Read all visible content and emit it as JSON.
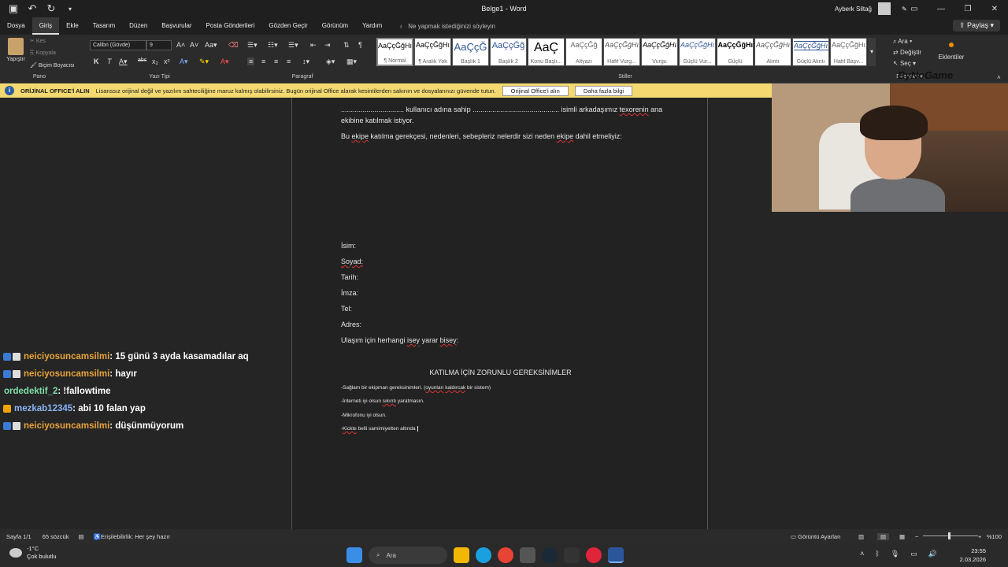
{
  "titlebar": {
    "doc_title": "Belge1  -  Word",
    "user_name": "Ayberk Siltağ",
    "qat": [
      "save-icon",
      "undo-icon",
      "redo-icon",
      "customize-icon"
    ]
  },
  "menu": {
    "tabs": [
      "Dosya",
      "Giriş",
      "Ekle",
      "Tasarım",
      "Düzen",
      "Başvurular",
      "Posta Gönderileri",
      "Gözden Geçir",
      "Görünüm",
      "Yardım"
    ],
    "active_index": 1,
    "tellme": "Ne yapmak istediğinizi söyleyin",
    "share": "Paylaş"
  },
  "ribbon": {
    "paste": "Yapıştır",
    "cut": "Kes",
    "copy": "Kopyala",
    "format_painter": "Biçim Boyacısı",
    "font": "Calibri (Gövde)",
    "size": "9",
    "groups": {
      "pano": "Pano",
      "yazi_tipi": "Yazı Tipi",
      "paragraf": "Paragraf",
      "stiller": "Stiller",
      "duzenleme": "Düzenleme"
    },
    "styles": [
      {
        "sample": "AaÇçĞğHı",
        "name": "¶ Normal"
      },
      {
        "sample": "AaÇçĞğHı",
        "name": "¶ Aralık Yok"
      },
      {
        "sample": "AaÇçĞ",
        "name": "Başlık 1"
      },
      {
        "sample": "AaÇçĞğ",
        "name": "Başlık 2"
      },
      {
        "sample": "AaÇ",
        "name": "Konu Başlı..."
      },
      {
        "sample": "AaÇçĞğ",
        "name": "Altyazı"
      },
      {
        "sample": "AaÇçĞğHı",
        "name": "Hafif Vurg..."
      },
      {
        "sample": "AaÇçĞğHı",
        "name": "Vurgu"
      },
      {
        "sample": "AaÇçĞğHı",
        "name": "Güçlü Vur..."
      },
      {
        "sample": "AaÇçĞğHı",
        "name": "Güçlü"
      },
      {
        "sample": "AaÇçĞğHı",
        "name": "Alıntı"
      },
      {
        "sample": "AaÇçĞğHı",
        "name": "Güçlü Alıntı"
      },
      {
        "sample": "AaÇçĞğHı",
        "name": "Hafif Başv..."
      }
    ],
    "find": "Ara",
    "replace": "Değiştir",
    "select": "Seç",
    "addins": "Eklentiler",
    "watermark": "ByNoGame"
  },
  "notice": {
    "title": "ORİJİNAL OFFICE'İ ALIN",
    "text": "Lisanssız orijinal değil ve yazılım sahteciliğine maruz kalmış olabilirsiniz. Bugün orijinal Office alarak kesintilerden sakının ve dosyalarınızı güvende tutun.",
    "btn_get": "Orijinal Office'i alın",
    "btn_more": "Daha fazla bilgi"
  },
  "document": {
    "line1a": "................................ kullanıcı adına sahip ............................................ isimli arkadaşımız ",
    "line1b": "texorenin",
    "line1c": " ana",
    "line2": "ekibine katılmak istiyor.",
    "line3a": "Bu ",
    "line3b": "ekipe",
    "line3c": " katılma gerekçesi, nedenleri, sebepleriz nelerdir sizi neden ",
    "line3d": "ekipe",
    "line3e": " dahil etmeliyiz:",
    "fields": [
      "İsim:",
      "Soyad:",
      "Tarih:",
      "İmza:",
      "Tel:",
      "Adres:"
    ],
    "contact_a": "Ulaşım için herhangi ",
    "contact_b": "isey",
    "contact_c": " yarar ",
    "contact_d": "bisey",
    "contact_e": ":",
    "heading": "KATILMA İÇİN ZORUNLU GEREKSİNİMLER",
    "req1a": "-Sağlam bir ekipman gereksinimleri. (",
    "req1b": "oyunları",
    "req1c": " ",
    "req1d": "kaldırcak",
    "req1e": " bir sistem)",
    "req2a": "-İnterneti iyi olsun ",
    "req2b": "sıkıntı",
    "req2c": " yaratmasın.",
    "req3": "-Mikrofonu iyi olsun.",
    "req4a": "-",
    "req4b": "Kickte",
    "req4c": " belli samimiyetten altında"
  },
  "chat": [
    {
      "user": "neiciyosuncamsilmi",
      "msg": " : 15 günü 3 ayda kasamadılar aq",
      "color": "#e8a33a",
      "badges": true
    },
    {
      "user": "neiciyosuncamsilmi",
      "msg": " : hayır",
      "color": "#e8a33a",
      "badges": true
    },
    {
      "user": "ordedektif_2",
      "msg": " : !fallowtime",
      "color": "#7fe0a8",
      "badges": false
    },
    {
      "user": "mezkab12345",
      "msg": " : abi 10 falan yap",
      "color": "#8ab4f8",
      "badges": "gold"
    },
    {
      "user": "neiciyosuncamsilmi",
      "msg": " : düşünmüyorum",
      "color": "#e8a33a",
      "badges": true
    }
  ],
  "status": {
    "page": "Sayfa 1/1",
    "words": "65 sözcük",
    "accessibility": "Erişilebilirlik: Her şey hazır",
    "display": "Görüntü Ayarları",
    "zoom": "%100"
  },
  "taskbar": {
    "temp": "-1°C",
    "weather": "Çok bulutlu",
    "weather_badge": "3",
    "search": "Ara",
    "time": "23:55",
    "date": "2.03.2026"
  },
  "colors": {
    "notice_bg": "#f3d970",
    "accent_orange": "#f08c00",
    "chat_user": "#e8a33a"
  }
}
